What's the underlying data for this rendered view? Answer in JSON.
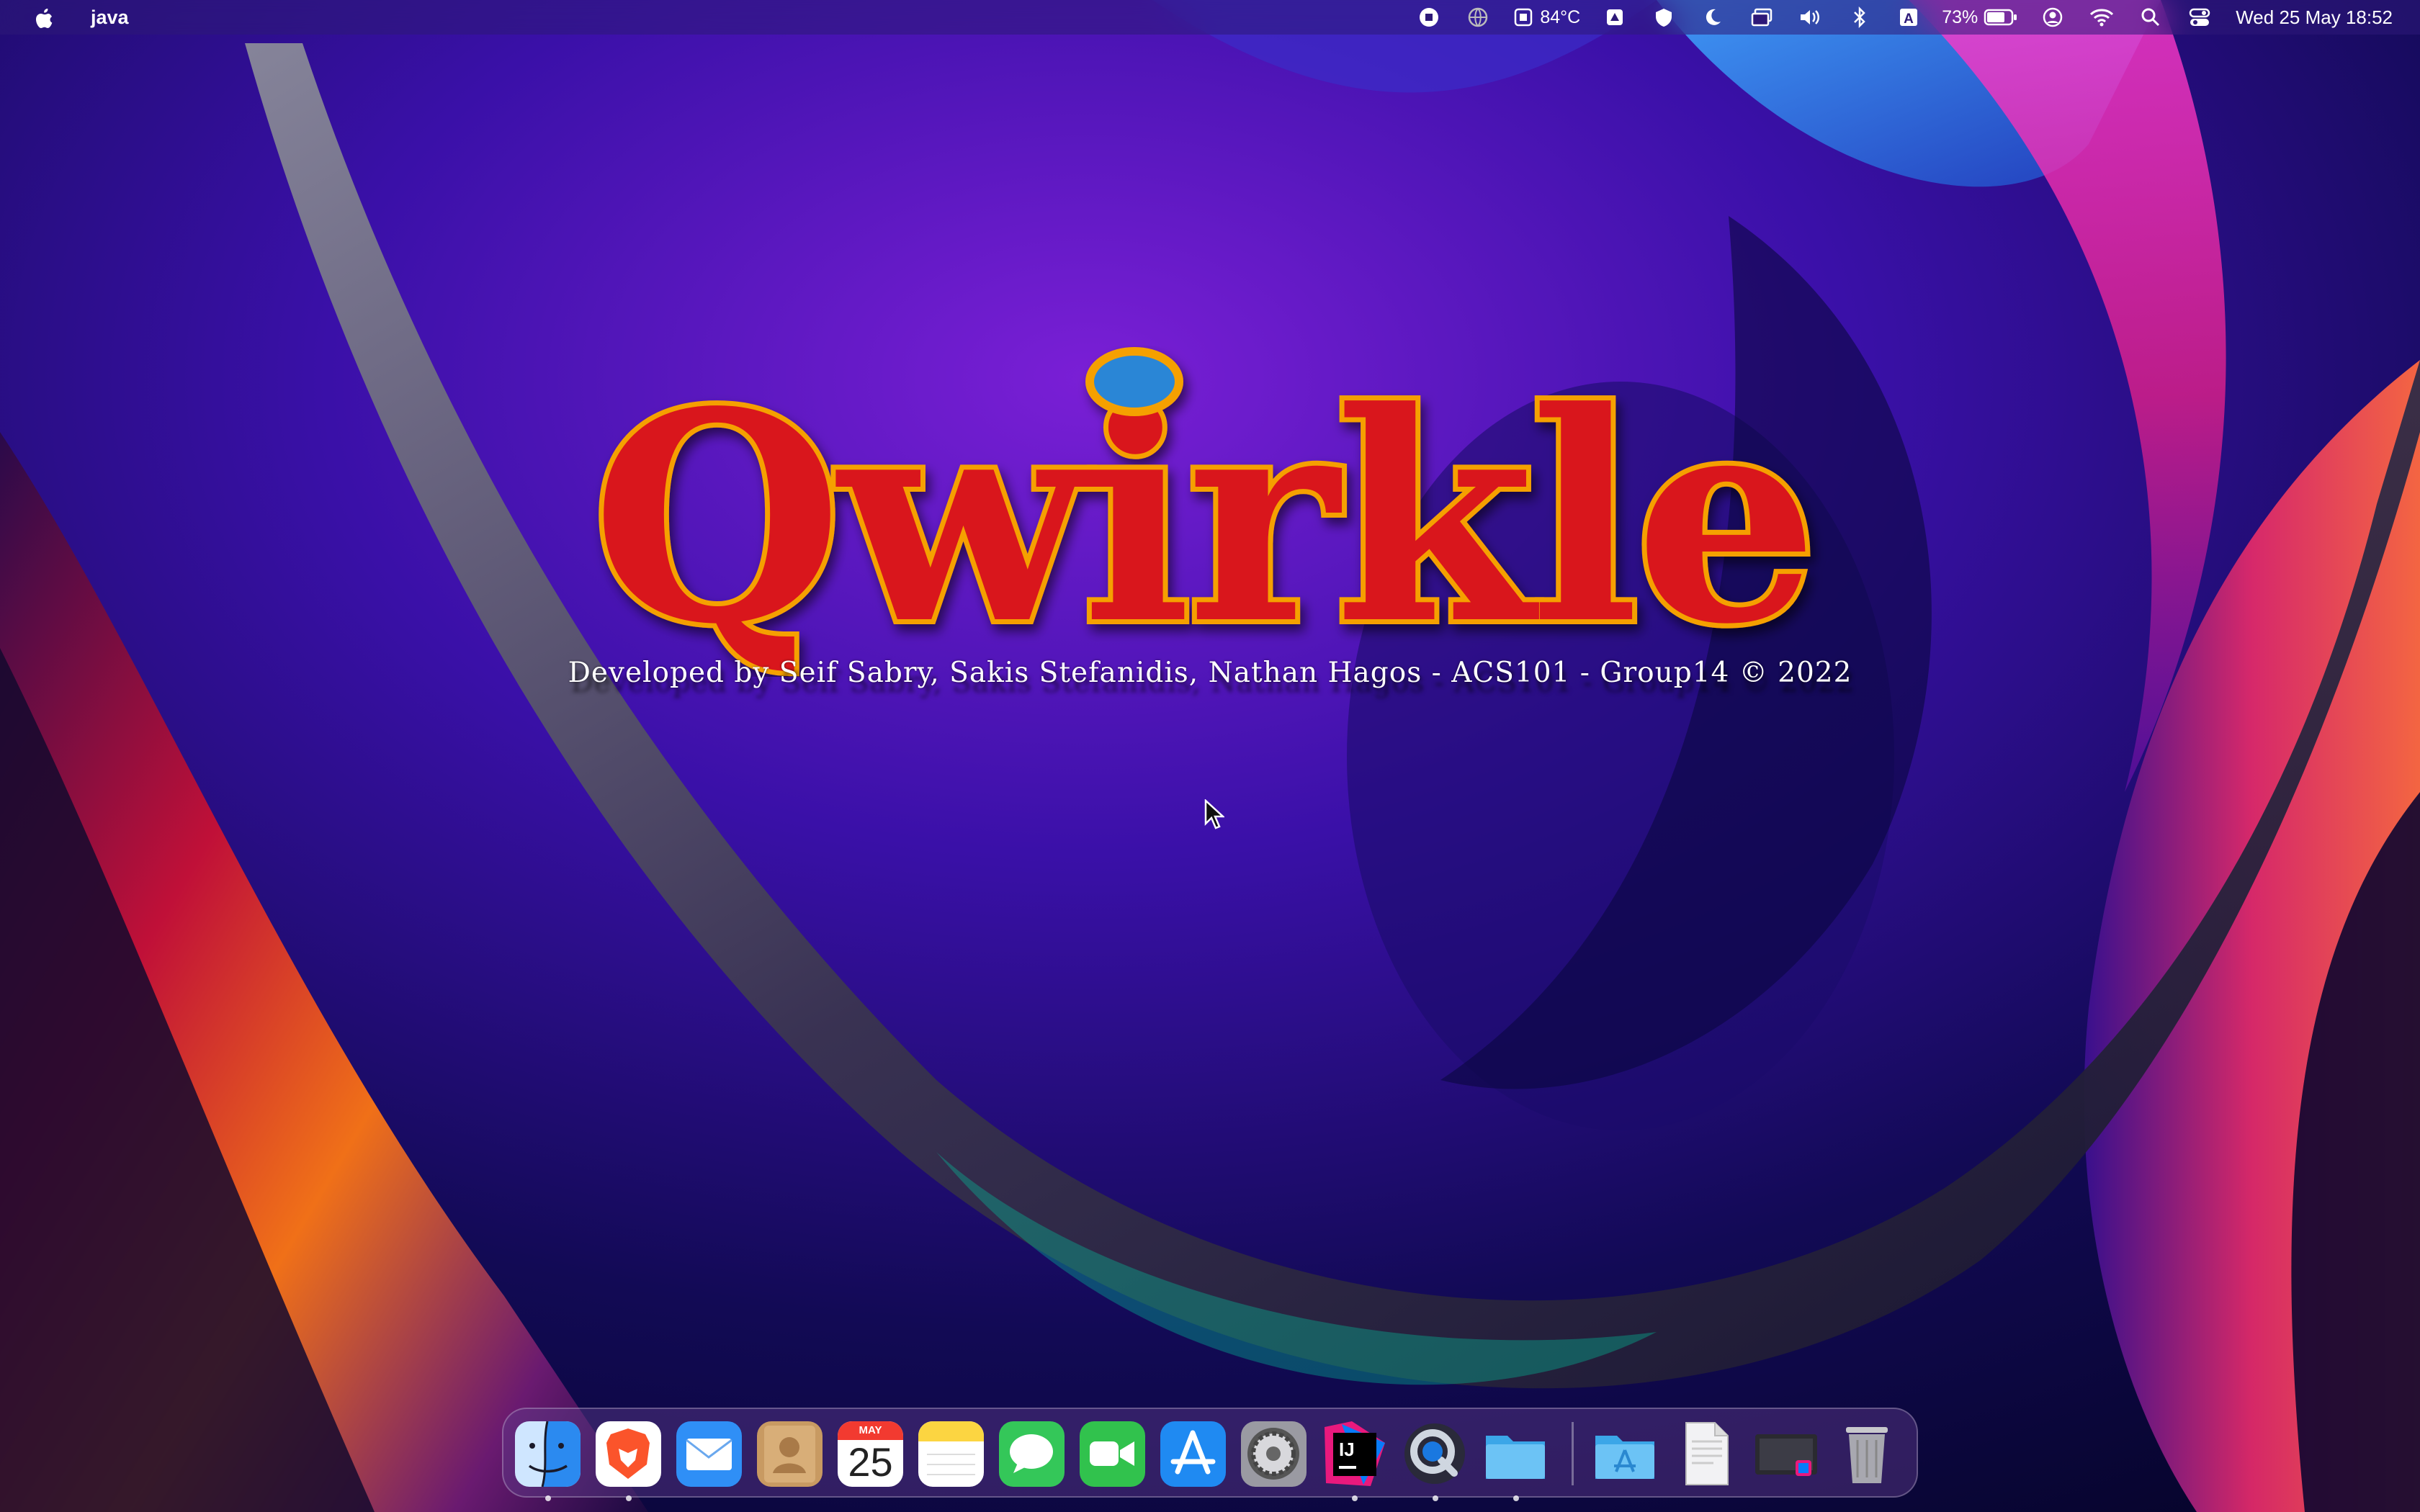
{
  "menubar": {
    "app_name": "java",
    "temperature": "84°C",
    "battery_percent": "73%",
    "clock": "Wed 25 May  18:52",
    "icons": [
      "apple-icon",
      "record-icon",
      "globe-icon",
      "temperature-icon",
      "drive-icon",
      "shield-icon",
      "moon-icon",
      "window-icon",
      "volume-icon",
      "bluetooth-icon",
      "keyboard-input-icon",
      "battery-icon",
      "user-icon",
      "wifi-icon",
      "search-icon",
      "control-center-icon"
    ]
  },
  "game": {
    "title": "Qwirkle",
    "credits": "Developed by Seif Sabry, Sakis Stefanidis, Nathan Hagos - ACS101 - Group14 © 2022"
  },
  "dock": {
    "calendar_month": "MAY",
    "calendar_day": "25",
    "apps": [
      "Finder",
      "Brave",
      "Mail",
      "Contacts",
      "Calendar",
      "Notes",
      "Messages",
      "FaceTime",
      "App Store",
      "System Preferences",
      "IntelliJ IDEA",
      "QuickTime Player",
      "Folder",
      "Applications",
      "Document",
      "Screenshot",
      "Trash"
    ]
  },
  "colors": {
    "menubar": "#2d1978",
    "logo_red": "#d9141b",
    "logo_outline": "#f5a000",
    "logo_dot": "#2a86d6"
  }
}
